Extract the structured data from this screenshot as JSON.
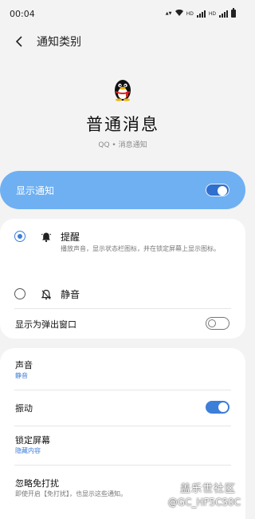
{
  "status_bar": {
    "time": "00:04",
    "indicators": [
      "HD",
      "HD"
    ]
  },
  "header": {
    "title": "通知类别"
  },
  "app": {
    "name": "普通消息",
    "subtitle": "QQ • 消息通知",
    "icon": "qq-penguin-icon"
  },
  "show_notifications": {
    "label": "显示通知",
    "enabled": true
  },
  "alert_options": [
    {
      "label": "提醒",
      "description": "播放声音，显示状态栏图标，并在锁定屏幕上显示图标。",
      "selected": true,
      "icon": "bell-icon"
    },
    {
      "label": "静音",
      "selected": false,
      "icon": "bell-off-icon"
    }
  ],
  "popup": {
    "label": "显示为弹出窗口",
    "enabled": false
  },
  "settings": {
    "sound": {
      "label": "声音",
      "value": "静音"
    },
    "vibration": {
      "label": "振动",
      "enabled": true
    },
    "lock_screen": {
      "label": "锁定屏幕",
      "value": "隐藏内容"
    },
    "dnd": {
      "label": "忽略免打扰",
      "description": "即使开启【免打扰】，也显示这些通知。"
    }
  },
  "watermark": {
    "line1": "盖乐世社区",
    "line2": "@GC_HF5CS0C"
  },
  "colors": {
    "accent": "#3d7ed9",
    "banner": "#6fb0f2",
    "background": "#f3f3f3"
  }
}
